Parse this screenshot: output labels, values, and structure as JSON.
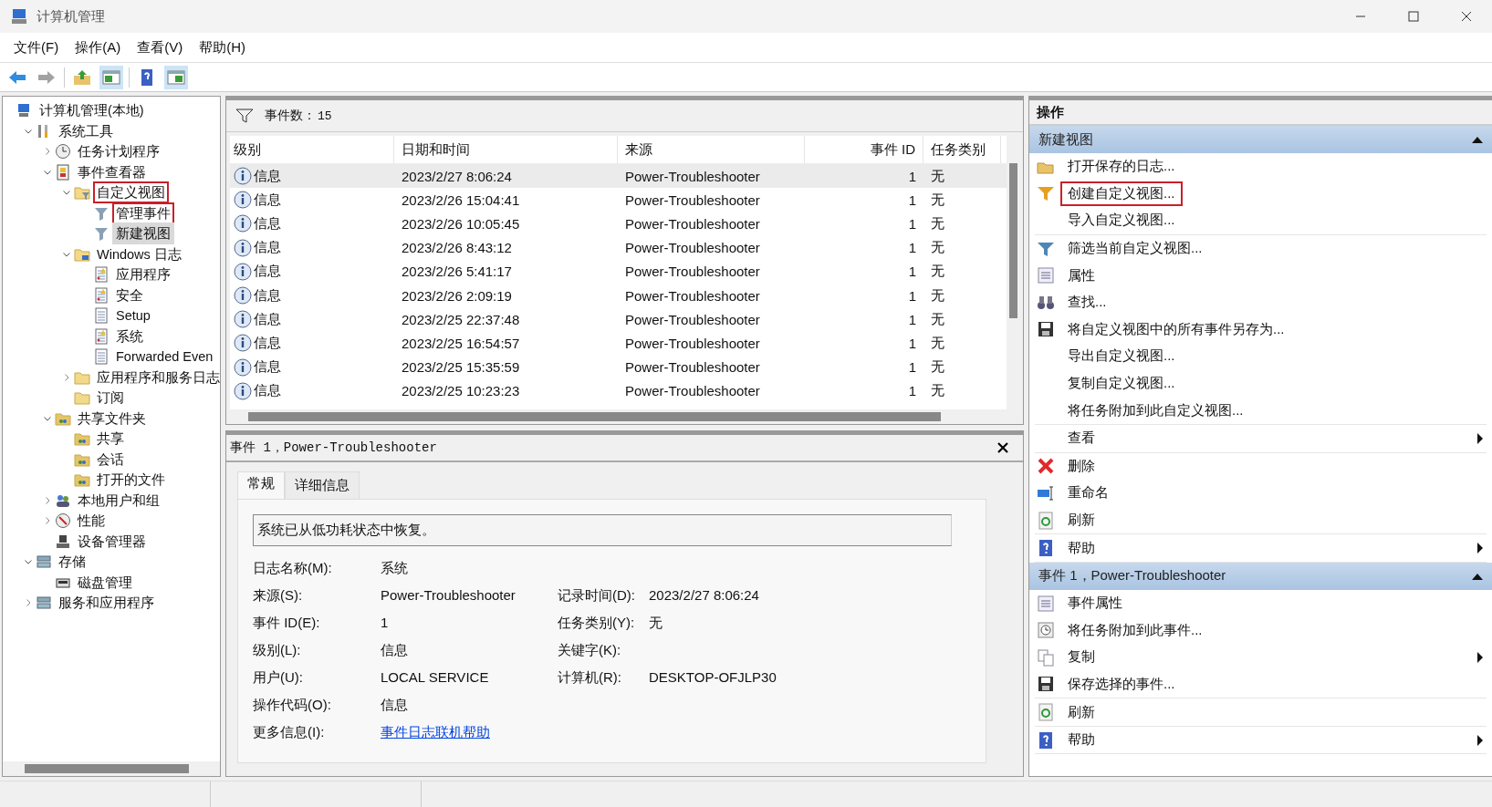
{
  "window": {
    "title": "计算机管理"
  },
  "menu": [
    "文件(F)",
    "操作(A)",
    "查看(V)",
    "帮助(H)"
  ],
  "toolbar_buttons": [
    {
      "pressed": false,
      "disabled": false
    },
    {
      "pressed": false,
      "disabled": true
    },
    {
      "pressed": false,
      "disabled": false
    },
    {
      "pressed": true,
      "disabled": false
    },
    {
      "pressed": false,
      "disabled": false
    },
    {
      "pressed": true,
      "disabled": false
    }
  ],
  "tree": [
    {
      "label": "计算机管理(本地)",
      "kind": "computer",
      "selected": false,
      "highlighted": false,
      "children": [
        {
          "label": "系统工具",
          "kind": "tools",
          "selected": false,
          "highlighted": false,
          "expanded": true,
          "children": [
            {
              "label": "任务计划程序",
              "kind": "clock",
              "selected": false,
              "highlighted": false,
              "expanded": false
            },
            {
              "label": "事件查看器",
              "kind": "viewer",
              "selected": false,
              "highlighted": false,
              "expanded": true,
              "children": [
                {
                  "label": "自定义视图",
                  "kind": "folder-filter",
                  "selected": false,
                  "highlighted": true,
                  "expanded": true,
                  "children": [
                    {
                      "label": "管理事件",
                      "kind": "filter",
                      "selected": false,
                      "highlighted": true
                    },
                    {
                      "label": "新建视图",
                      "kind": "filter",
                      "selected": true,
                      "highlighted": false
                    }
                  ]
                },
                {
                  "label": "Windows 日志",
                  "kind": "folder-log",
                  "selected": false,
                  "highlighted": false,
                  "expanded": true,
                  "children": [
                    {
                      "label": "应用程序",
                      "kind": "log-warn",
                      "selected": false,
                      "highlighted": false
                    },
                    {
                      "label": "安全",
                      "kind": "log-warn",
                      "selected": false,
                      "highlighted": false
                    },
                    {
                      "label": "Setup",
                      "kind": "log",
                      "selected": false,
                      "highlighted": false
                    },
                    {
                      "label": "系统",
                      "kind": "log-warn",
                      "selected": false,
                      "highlighted": false
                    },
                    {
                      "label": "Forwarded Even",
                      "kind": "log",
                      "selected": false,
                      "highlighted": false
                    }
                  ]
                },
                {
                  "label": "应用程序和服务日志",
                  "kind": "folder",
                  "selected": false,
                  "highlighted": false,
                  "expanded": false
                },
                {
                  "label": "订阅",
                  "kind": "folder",
                  "selected": false,
                  "highlighted": false
                }
              ]
            },
            {
              "label": "共享文件夹",
              "kind": "share",
              "selected": false,
              "highlighted": false,
              "expanded": true,
              "children": [
                {
                  "label": "共享",
                  "kind": "share",
                  "selected": false,
                  "highlighted": false
                },
                {
                  "label": "会话",
                  "kind": "share",
                  "selected": false,
                  "highlighted": false
                },
                {
                  "label": "打开的文件",
                  "kind": "share",
                  "selected": false,
                  "highlighted": false
                }
              ]
            },
            {
              "label": "本地用户和组",
              "kind": "users",
              "selected": false,
              "highlighted": false,
              "expanded": false
            },
            {
              "label": "性能",
              "kind": "perf",
              "selected": false,
              "highlighted": false,
              "expanded": false
            },
            {
              "label": "设备管理器",
              "kind": "device",
              "selected": false,
              "highlighted": false
            }
          ]
        },
        {
          "label": "存储",
          "kind": "storage",
          "selected": false,
          "highlighted": false,
          "expanded": true,
          "children": [
            {
              "label": "磁盘管理",
              "kind": "disk",
              "selected": false,
              "highlighted": false
            }
          ]
        },
        {
          "label": "服务和应用程序",
          "kind": "services",
          "selected": false,
          "highlighted": false,
          "expanded": false
        }
      ]
    }
  ],
  "events": {
    "count_label": "事件数：",
    "count": "15",
    "columns": [
      "级别",
      "日期和时间",
      "来源",
      "事件 ID",
      "任务类别"
    ],
    "rows": [
      {
        "level": "信息",
        "datetime": "2023/2/27 8:06:24",
        "source": "Power-Troubleshooter",
        "event_id": "1",
        "category": "无",
        "selected": true
      },
      {
        "level": "信息",
        "datetime": "2023/2/26 15:04:41",
        "source": "Power-Troubleshooter",
        "event_id": "1",
        "category": "无",
        "selected": false
      },
      {
        "level": "信息",
        "datetime": "2023/2/26 10:05:45",
        "source": "Power-Troubleshooter",
        "event_id": "1",
        "category": "无",
        "selected": false
      },
      {
        "level": "信息",
        "datetime": "2023/2/26 8:43:12",
        "source": "Power-Troubleshooter",
        "event_id": "1",
        "category": "无",
        "selected": false
      },
      {
        "level": "信息",
        "datetime": "2023/2/26 5:41:17",
        "source": "Power-Troubleshooter",
        "event_id": "1",
        "category": "无",
        "selected": false
      },
      {
        "level": "信息",
        "datetime": "2023/2/26 2:09:19",
        "source": "Power-Troubleshooter",
        "event_id": "1",
        "category": "无",
        "selected": false
      },
      {
        "level": "信息",
        "datetime": "2023/2/25 22:37:48",
        "source": "Power-Troubleshooter",
        "event_id": "1",
        "category": "无",
        "selected": false
      },
      {
        "level": "信息",
        "datetime": "2023/2/25 16:54:57",
        "source": "Power-Troubleshooter",
        "event_id": "1",
        "category": "无",
        "selected": false
      },
      {
        "level": "信息",
        "datetime": "2023/2/25 15:35:59",
        "source": "Power-Troubleshooter",
        "event_id": "1",
        "category": "无",
        "selected": false
      },
      {
        "level": "信息",
        "datetime": "2023/2/25 10:23:23",
        "source": "Power-Troubleshooter",
        "event_id": "1",
        "category": "无",
        "selected": false
      }
    ]
  },
  "detail": {
    "title": "事件 1，Power-Troubleshooter",
    "tabs": [
      {
        "label": "常规",
        "selected": true
      },
      {
        "label": "详细信息",
        "selected": false
      }
    ],
    "message": "系统已从低功耗状态中恢复。",
    "rows": [
      {
        "left": {
          "label": "日志名称(M):",
          "value": "系统"
        }
      },
      {
        "left": {
          "label": "来源(S):",
          "value": "Power-Troubleshooter"
        },
        "right": {
          "label": "记录时间(D):",
          "value": "2023/2/27 8:06:24"
        }
      },
      {
        "left": {
          "label": "事件 ID(E):",
          "value": "1"
        },
        "right": {
          "label": "任务类别(Y):",
          "value": "无"
        }
      },
      {
        "left": {
          "label": "级别(L):",
          "value": "信息"
        },
        "right": {
          "label": "关键字(K):"
        }
      },
      {
        "left": {
          "label": "用户(U):",
          "value": "LOCAL SERVICE"
        },
        "right": {
          "label": "计算机(R):",
          "value": "DESKTOP-OFJLP30"
        }
      },
      {
        "left": {
          "label": "操作代码(O):",
          "value": "信息"
        }
      },
      {
        "left": {
          "label": "更多信息(I):",
          "link": "事件日志联机帮助"
        }
      }
    ]
  },
  "actions": {
    "title": "操作",
    "sections": [
      {
        "title": "新建视图",
        "expanded": true,
        "groups": [
          [
            {
              "label": "打开保存的日志...",
              "submenu": false,
              "highlighted": false
            },
            {
              "label": "创建自定义视图...",
              "submenu": false,
              "highlighted": true
            },
            {
              "label": "导入自定义视图...",
              "submenu": false,
              "highlighted": false
            }
          ],
          [
            {
              "label": "筛选当前自定义视图...",
              "submenu": false,
              "highlighted": false
            },
            {
              "label": "属性",
              "submenu": false,
              "highlighted": false
            },
            {
              "label": "查找...",
              "submenu": false,
              "highlighted": false
            },
            {
              "label": "将自定义视图中的所有事件另存为...",
              "submenu": false,
              "highlighted": false
            },
            {
              "label": "导出自定义视图...",
              "submenu": false,
              "highlighted": false
            },
            {
              "label": "复制自定义视图...",
              "submenu": false,
              "highlighted": false
            },
            {
              "label": "将任务附加到此自定义视图...",
              "submenu": false,
              "highlighted": false
            }
          ],
          [
            {
              "label": "查看",
              "submenu": true,
              "highlighted": false
            }
          ],
          [
            {
              "label": "删除",
              "submenu": false,
              "highlighted": false
            },
            {
              "label": "重命名",
              "submenu": false,
              "highlighted": false
            },
            {
              "label": "刷新",
              "submenu": false,
              "highlighted": false
            }
          ],
          [
            {
              "label": "帮助",
              "submenu": true,
              "highlighted": false
            }
          ]
        ]
      },
      {
        "title": "事件 1，Power-Troubleshooter",
        "expanded": true,
        "groups": [
          [
            {
              "label": "事件属性",
              "submenu": false,
              "highlighted": false
            },
            {
              "label": "将任务附加到此事件...",
              "submenu": false,
              "highlighted": false
            },
            {
              "label": "复制",
              "submenu": true,
              "highlighted": false
            },
            {
              "label": "保存选择的事件...",
              "submenu": false,
              "highlighted": false
            }
          ],
          [
            {
              "label": "刷新",
              "submenu": false,
              "highlighted": false
            }
          ],
          [
            {
              "label": "帮助",
              "submenu": true,
              "highlighted": false
            }
          ]
        ]
      }
    ]
  }
}
